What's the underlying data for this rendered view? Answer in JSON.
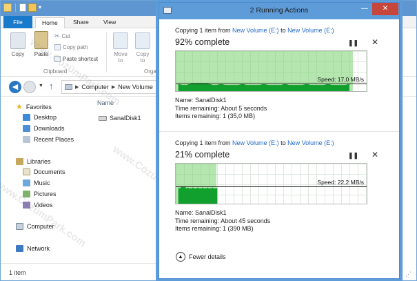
{
  "explorer": {
    "tabs": {
      "file": "File",
      "home": "Home",
      "share": "Share",
      "view": "View"
    },
    "ribbon": {
      "copy": "Copy",
      "paste": "Paste",
      "cut": "Cut",
      "copy_path": "Copy path",
      "paste_shortcut": "Paste shortcut",
      "clipboard_label": "Clipboard",
      "move_to": "Move\nto",
      "copy_to": "Copy\nto",
      "organize_label": "Orga"
    },
    "address": {
      "seg1": "Computer",
      "seg2": "New Volume"
    },
    "sidebar": {
      "favorites": "Favorites",
      "desktop": "Desktop",
      "downloads": "Downloads",
      "recent": "Recent Places",
      "libraries": "Libraries",
      "documents": "Documents",
      "music": "Music",
      "pictures": "Pictures",
      "videos": "Videos",
      "computer": "Computer",
      "network": "Network"
    },
    "content": {
      "column_name": "Name",
      "file": "SanalDisk1"
    },
    "status": "1 item",
    "watermark": "www.CözümPark.com"
  },
  "dialog": {
    "title": "2 Running Actions",
    "operations": [
      {
        "prefix": "Copying 1 item from ",
        "from": "New Volume (E:)",
        "to_word": " to ",
        "to": "New Volume (E:)",
        "percent_text": "92% complete",
        "progress": 0.92,
        "speed": "Speed: 17,0 MB/s",
        "speed_level": 0.22,
        "name": "Name: SanalDisk1",
        "time_remaining": "Time remaining:  About 5 seconds",
        "items_remaining": "Items remaining:  1 (35,0 MB)"
      },
      {
        "prefix": "Copying 1 item from ",
        "from": "New Volume (E:)",
        "to_word": " to ",
        "to": "New Volume (E:)",
        "percent_text": "21% complete",
        "progress": 0.21,
        "speed": "Speed: 22,2 MB/s",
        "speed_level": 0.45,
        "name": "Name: SanalDisk1",
        "time_remaining": "Time remaining:  About 45 seconds",
        "items_remaining": "Items remaining:  1 (390 MB)"
      }
    ],
    "pause_icon": "pause-icon",
    "cancel_icon": "cancel-icon",
    "fewer_details": "Fewer details",
    "min_glyph": "—",
    "close_glyph": "✕"
  },
  "colors": {
    "accent": "#5e9bd9",
    "link": "#2068c4",
    "graph_green": "#11a02d",
    "close_red": "#c7463b"
  }
}
